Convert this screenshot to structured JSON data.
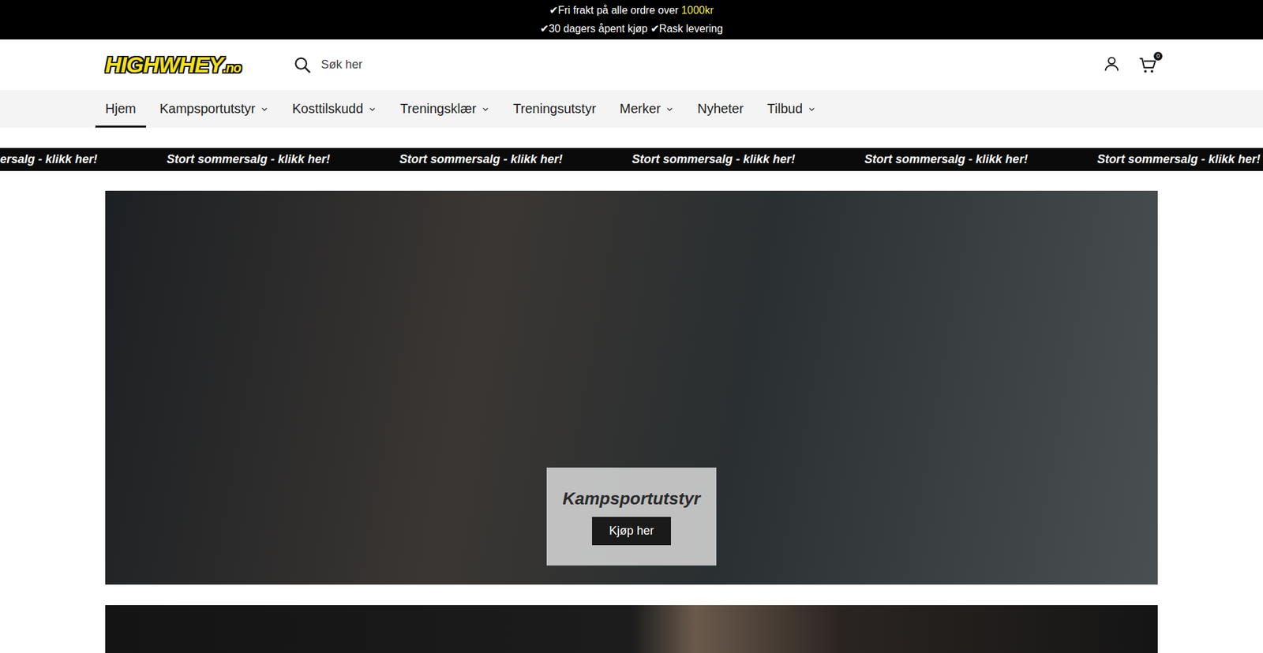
{
  "announcement": {
    "lines": [
      {
        "parts": [
          {
            "text": "✔Fri frakt på alle ordre over ",
            "highlight": false
          },
          {
            "text": "1000kr",
            "highlight": true
          }
        ]
      },
      {
        "parts": [
          {
            "text": "✔30 dagers åpent kjøp ✔Rask levering",
            "highlight": false
          }
        ]
      }
    ]
  },
  "logo": {
    "text": "HIGHWHEY",
    "suffix": ".no"
  },
  "search": {
    "placeholder": "Søk her"
  },
  "cart": {
    "count": "0"
  },
  "nav": [
    {
      "label": "Hjem",
      "selected": true,
      "kind": "link"
    },
    {
      "label": "Kampsportutstyr",
      "selected": false,
      "kind": "menu"
    },
    {
      "label": "Kosttilskudd",
      "selected": false,
      "kind": "menu"
    },
    {
      "label": "Treningsklær",
      "selected": false,
      "kind": "menu"
    },
    {
      "label": "Treningsutstyr",
      "selected": false,
      "kind": "link"
    },
    {
      "label": "Merker",
      "selected": false,
      "kind": "menu"
    },
    {
      "label": "Nyheter",
      "selected": false,
      "kind": "link"
    },
    {
      "label": "Tilbud",
      "selected": false,
      "kind": "menu"
    }
  ],
  "marquee": [
    "ersalg - klikk her!",
    "Stort sommersalg - klikk her!",
    "Stort sommersalg - klikk her!",
    "Stort sommersalg - klikk her!",
    "Stort sommersalg - klikk her!",
    "Stort sommersalg - klikk her!"
  ],
  "hero": {
    "title": "Kampsportutstyr",
    "button": "Kjøp her"
  }
}
